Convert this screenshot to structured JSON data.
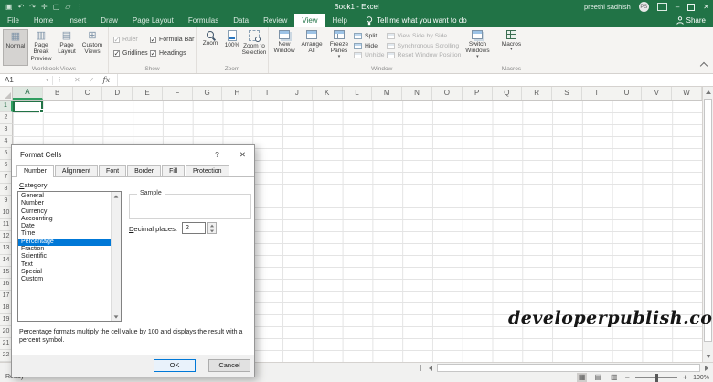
{
  "titlebar": {
    "title": "Book1 - Excel",
    "user": "preethi sadhish",
    "avatar": "PS",
    "qat_icons": [
      {
        "name": "save-icon",
        "glyph": "▣"
      },
      {
        "name": "undo-icon",
        "glyph": "↶"
      },
      {
        "name": "redo-icon",
        "glyph": "↷"
      },
      {
        "name": "touch-mode-icon",
        "glyph": "✛"
      },
      {
        "name": "new-file-icon",
        "glyph": "▢"
      },
      {
        "name": "open-file-icon",
        "glyph": "▱"
      },
      {
        "name": "customize-qat-icon",
        "glyph": "⋮"
      }
    ]
  },
  "tabs": {
    "items": [
      "File",
      "Home",
      "Insert",
      "Draw",
      "Page Layout",
      "Formulas",
      "Data",
      "Review",
      "View",
      "Help"
    ],
    "active": "View",
    "tell_me": "Tell me what you want to do",
    "share": "Share"
  },
  "ribbon": {
    "workbook_views": {
      "label": "Workbook Views",
      "buttons": [
        {
          "label": "Normal",
          "icon": "normal-view-icon",
          "glyph": "▦",
          "pressed": true
        },
        {
          "label": "Page Break Preview",
          "icon": "page-break-preview-icon",
          "glyph": "▥",
          "pressed": false
        },
        {
          "label": "Page Layout",
          "icon": "page-layout-icon",
          "glyph": "▤",
          "pressed": false
        },
        {
          "label": "Custom Views",
          "icon": "custom-views-icon",
          "glyph": "⊞",
          "pressed": false
        }
      ]
    },
    "show": {
      "label": "Show",
      "checkboxes": [
        {
          "label": "Ruler",
          "checked": true,
          "disabled": true
        },
        {
          "label": "Formula Bar",
          "checked": true,
          "disabled": false
        },
        {
          "label": "Gridlines",
          "checked": true,
          "disabled": false
        },
        {
          "label": "Headings",
          "checked": true,
          "disabled": false
        }
      ]
    },
    "zoom": {
      "label": "Zoom",
      "buttons": [
        {
          "label": "Zoom",
          "icon": "zoom-icon",
          "kind": "mag"
        },
        {
          "label": "100%",
          "icon": "zoom-100-icon",
          "kind": "page"
        },
        {
          "label": "Zoom to Selection",
          "icon": "zoom-to-selection-icon",
          "kind": "magsel"
        }
      ]
    },
    "window": {
      "label": "Window",
      "big_buttons": [
        {
          "label": "New Window",
          "icon": "new-window-icon",
          "dropdown": false
        },
        {
          "label": "Arrange All",
          "icon": "arrange-all-icon",
          "dropdown": false
        },
        {
          "label": "Freeze Panes",
          "icon": "freeze-panes-icon",
          "dropdown": true
        }
      ],
      "small_buttons": [
        {
          "label": "Split",
          "icon": "split-icon",
          "disabled": false
        },
        {
          "label": "Hide",
          "icon": "hide-icon",
          "disabled": false
        },
        {
          "label": "Unhide",
          "icon": "unhide-icon",
          "disabled": true
        },
        {
          "label": "View Side by Side",
          "icon": "view-side-by-side-icon",
          "disabled": true
        },
        {
          "label": "Synchronous Scrolling",
          "icon": "synchronous-scrolling-icon",
          "disabled": true
        },
        {
          "label": "Reset Window Position",
          "icon": "reset-window-position-icon",
          "disabled": true
        }
      ],
      "switch_windows": {
        "label": "Switch Windows",
        "icon": "switch-windows-icon",
        "dropdown": true
      }
    },
    "macros": {
      "label": "Macros",
      "button": {
        "label": "Macros",
        "icon": "macros-icon",
        "dropdown": true
      }
    }
  },
  "formula_bar": {
    "name_box": "A1",
    "cancel": "✕",
    "enter": "✓",
    "fx": "fx",
    "formula": ""
  },
  "grid": {
    "columns": [
      "A",
      "B",
      "C",
      "D",
      "E",
      "F",
      "G",
      "H",
      "I",
      "J",
      "K",
      "L",
      "M",
      "N",
      "O",
      "P",
      "Q",
      "R",
      "S",
      "T",
      "U",
      "V",
      "W"
    ],
    "rows": [
      1,
      2,
      3,
      4,
      5,
      6,
      7,
      8,
      9,
      10,
      11,
      12,
      13,
      14,
      15,
      16,
      17,
      18,
      19,
      20,
      21,
      22
    ],
    "selected_cell": "A1",
    "selected_column": "A",
    "selected_row": 1
  },
  "dialog": {
    "title": "Format Cells",
    "help": "?",
    "close": "✕",
    "tabs": [
      "Number",
      "Alignment",
      "Font",
      "Border",
      "Fill",
      "Protection"
    ],
    "active_tab": "Number",
    "category_label": "Category:",
    "categories": [
      "General",
      "Number",
      "Currency",
      "Accounting",
      "Date",
      "Time",
      "Percentage",
      "Fraction",
      "Scientific",
      "Text",
      "Special",
      "Custom"
    ],
    "selected_category": "Percentage",
    "sample_label": "Sample",
    "decimal_label": "Decimal places:",
    "decimal_value": "2",
    "description": "Percentage formats multiply the cell value by 100 and displays the result with a percent symbol.",
    "ok": "OK",
    "cancel": "Cancel"
  },
  "status_bar": {
    "ready": "Ready",
    "zoom_value": "100%"
  },
  "watermark": "developerpublish.com",
  "colors": {
    "excel_green": "#217346",
    "selection_blue": "#0078d7",
    "selected_header_green": "#2f9e60"
  }
}
